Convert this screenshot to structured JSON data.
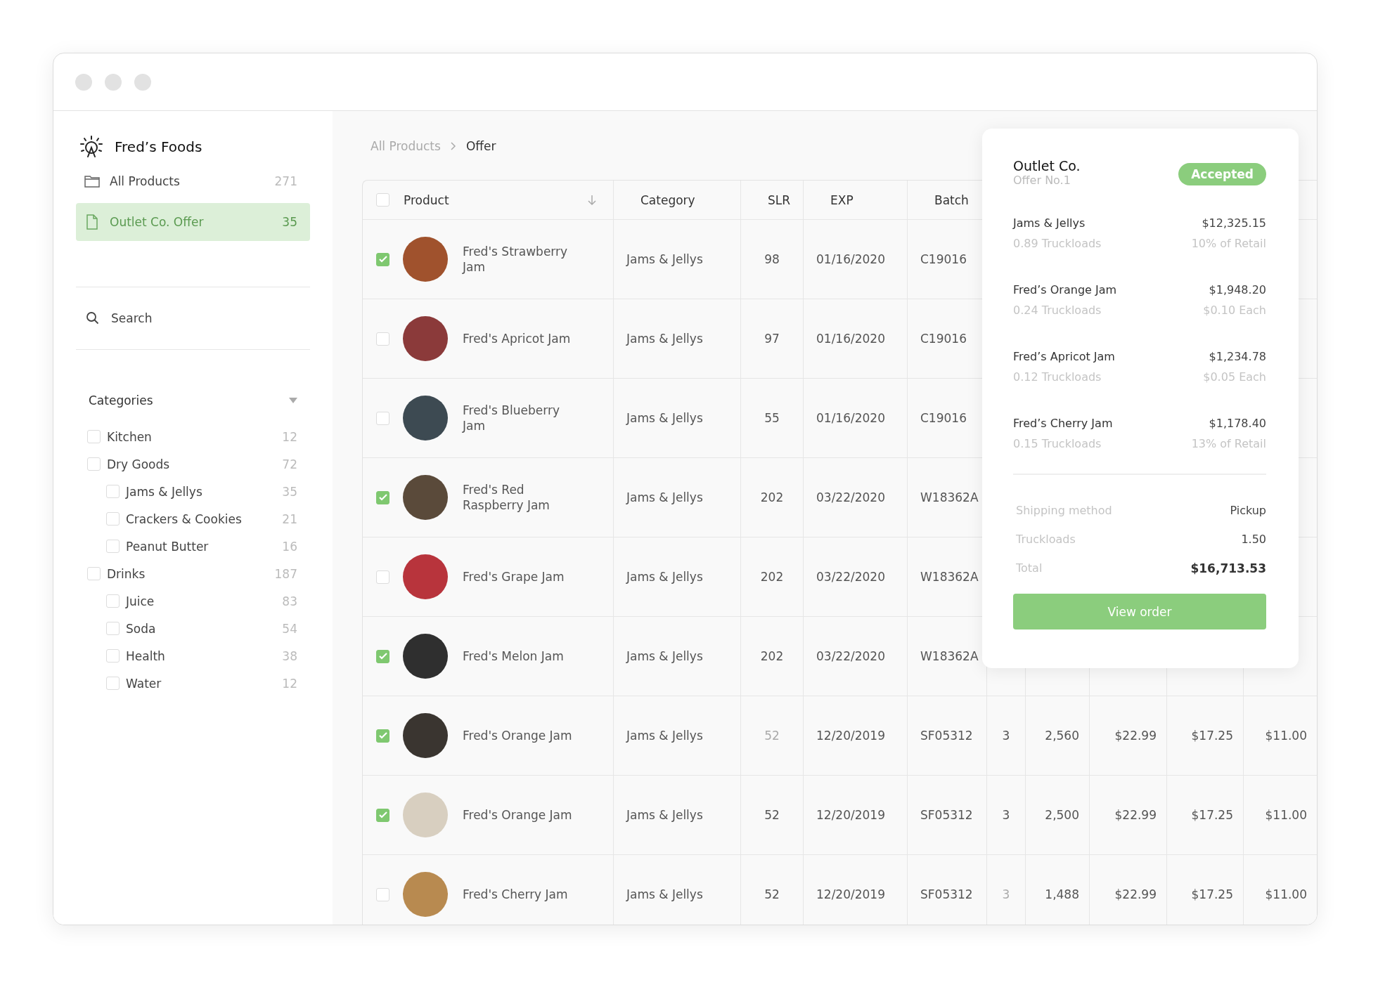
{
  "sidebar": {
    "brand": "Fred’s Foods",
    "nav": [
      {
        "label": "All Products",
        "count": "271",
        "selected": false
      },
      {
        "label": "Outlet Co. Offer",
        "count": "35",
        "selected": true
      }
    ],
    "search": {
      "placeholder": "Search"
    },
    "categories": {
      "title": "Categories",
      "expanded": true,
      "items": [
        {
          "label": "Kitchen",
          "count": "12",
          "checked": false
        },
        {
          "label": "Dry Goods",
          "count": "72",
          "checked": false,
          "children": [
            {
              "label": "Jams & Jellys",
              "count": "35",
              "checked": false
            },
            {
              "label": "Crackers & Cookies",
              "count": "21",
              "checked": false
            },
            {
              "label": "Peanut Butter",
              "count": "16",
              "checked": false
            }
          ]
        },
        {
          "label": "Drinks",
          "count": "187",
          "checked": false,
          "children": [
            {
              "label": "Juice",
              "count": "83",
              "checked": false
            },
            {
              "label": "Soda",
              "count": "54",
              "checked": false
            },
            {
              "label": "Health",
              "count": "38",
              "checked": false
            },
            {
              "label": "Water",
              "count": "12",
              "checked": false
            }
          ]
        }
      ]
    }
  },
  "breadcrumb": [
    "All Products",
    "Offer"
  ],
  "table": {
    "all_checked": false,
    "columns": [
      "Product",
      "Category",
      "SLR",
      "EXP",
      "Batch"
    ],
    "rows": [
      {
        "checked": true,
        "product": "Fred's Strawberry Jam",
        "category": "Jams & Jellys",
        "slr": "98",
        "slr_muted": false,
        "exp": "01/16/2020",
        "batch": "C19016"
      },
      {
        "checked": false,
        "product": "Fred's Apricot Jam",
        "category": "Jams & Jellys",
        "slr": "97",
        "slr_muted": false,
        "exp": "01/16/2020",
        "batch": "C19016"
      },
      {
        "checked": false,
        "product": "Fred's Blueberry Jam",
        "category": "Jams & Jellys",
        "slr": "55",
        "slr_muted": false,
        "exp": "01/16/2020",
        "batch": "C19016"
      },
      {
        "checked": true,
        "product": "Fred's Red Raspberry Jam",
        "category": "Jams & Jellys",
        "slr": "202",
        "slr_muted": false,
        "exp": "03/22/2020",
        "batch": "W18362A"
      },
      {
        "checked": false,
        "product": "Fred's Grape Jam",
        "category": "Jams & Jellys",
        "slr": "202",
        "slr_muted": false,
        "exp": "03/22/2020",
        "batch": "W18362A"
      },
      {
        "checked": true,
        "product": "Fred's Melon Jam",
        "category": "Jams & Jellys",
        "slr": "202",
        "slr_muted": false,
        "exp": "03/22/2020",
        "batch": "W18362A"
      },
      {
        "checked": true,
        "product": "Fred's Orange Jam",
        "category": "Jams & Jellys",
        "slr": "52",
        "slr_muted": true,
        "exp": "12/20/2019",
        "batch": "SF05312",
        "column_6": "3",
        "column_6_muted": false,
        "column_7": "2,560",
        "column_8": "$22.99",
        "column_9": "$17.25",
        "column_10": "$11.00"
      },
      {
        "checked": true,
        "product": "Fred's Orange Jam",
        "category": "Jams & Jellys",
        "slr": "52",
        "slr_muted": false,
        "exp": "12/20/2019",
        "batch": "SF05312",
        "column_6": "3",
        "column_6_muted": false,
        "column_7": "2,500",
        "column_8": "$22.99",
        "column_9": "$17.25",
        "column_10": "$11.00"
      },
      {
        "checked": false,
        "product": "Fred's Cherry Jam",
        "category": "Jams & Jellys",
        "slr": "52",
        "slr_muted": false,
        "exp": "12/20/2019",
        "batch": "SF05312",
        "column_6": "3",
        "column_6_muted": true,
        "column_7": "1,488",
        "column_8": "$22.99",
        "column_9": "$17.25",
        "column_10": "$11.00"
      }
    ]
  },
  "offer": {
    "title": "Outlet Co.",
    "subtitle": "Offer No.1",
    "status": "Accepted",
    "items": [
      {
        "name": "Jams & Jellys",
        "amount": "$12,325.15",
        "truckloads": "0.89 Truckloads",
        "note": "10% of Retail"
      },
      {
        "name": "Fred’s Orange Jam",
        "amount": "$1,948.20",
        "truckloads": "0.24 Truckloads",
        "note": "$0.10 Each"
      },
      {
        "name": "Fred’s Apricot Jam",
        "amount": "$1,234.78",
        "truckloads": "0.12 Truckloads",
        "note": "$0.05 Each"
      },
      {
        "name": "Fred’s Cherry Jam",
        "amount": "$1,178.40",
        "truckloads": "0.15 Truckloads",
        "note": "13% of Retail"
      }
    ],
    "summary": [
      {
        "label": "Shipping method",
        "value": "Pickup",
        "kind": "plain"
      },
      {
        "label": "Truckloads",
        "value": "1.50",
        "kind": "plain"
      },
      {
        "label": "Total",
        "value": "$16,713.53",
        "kind": "total"
      }
    ],
    "button": "View order"
  }
}
